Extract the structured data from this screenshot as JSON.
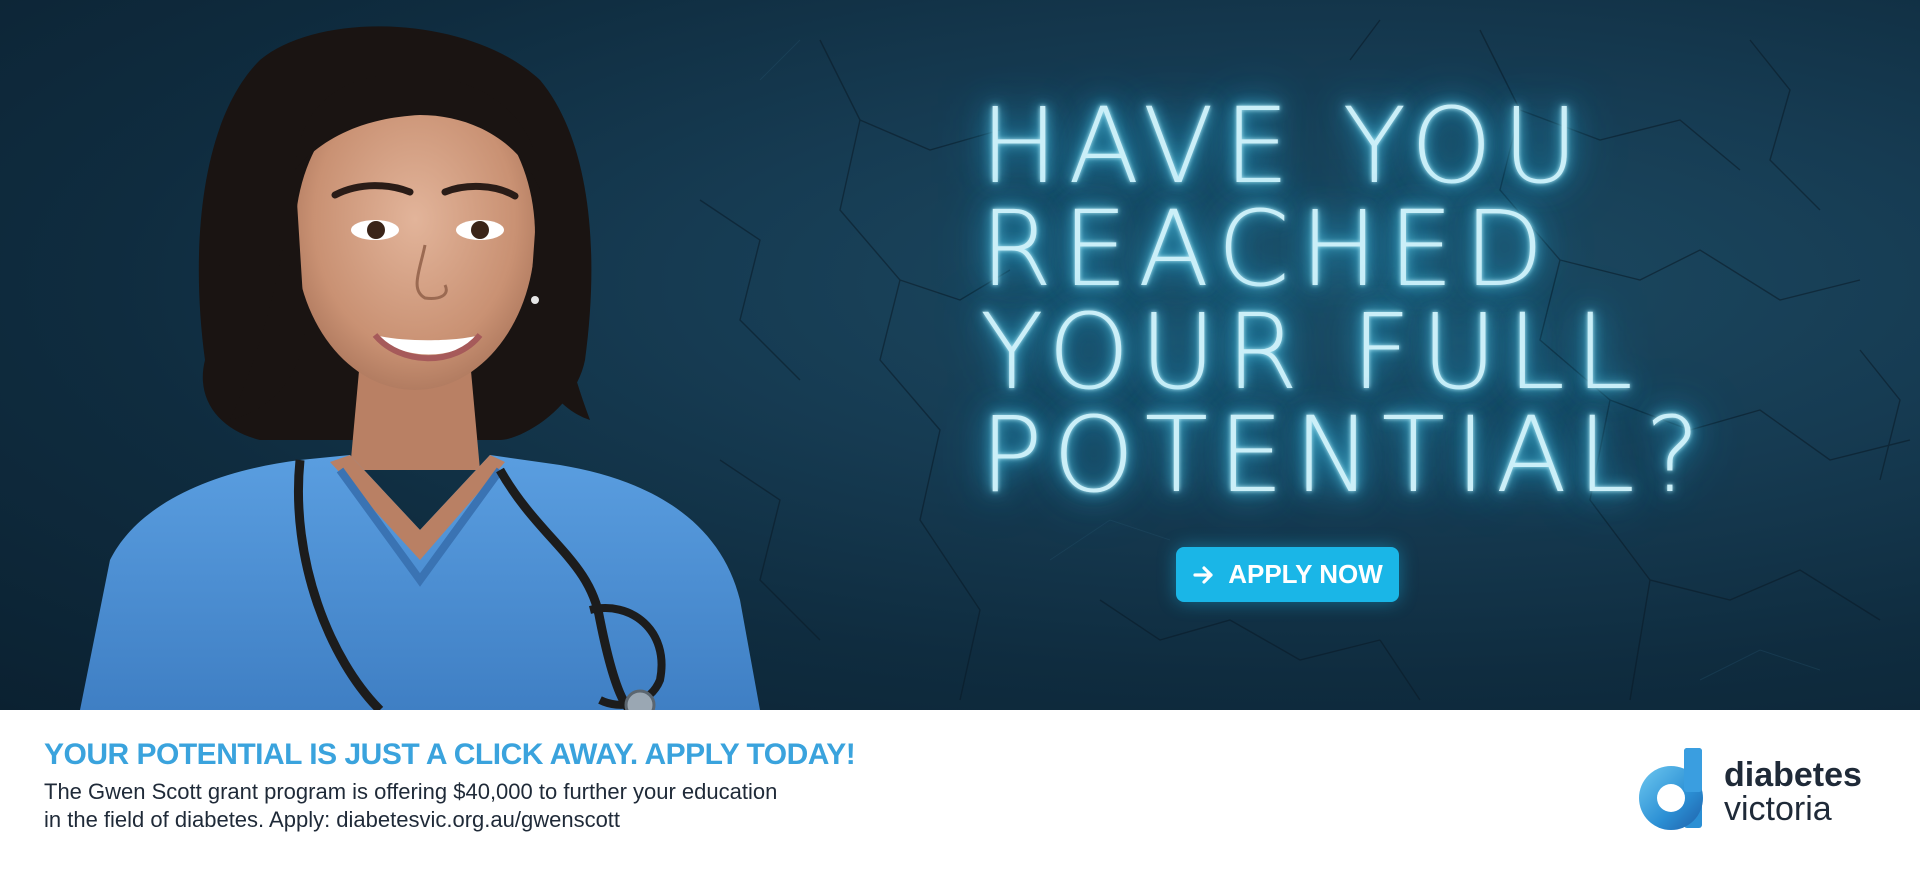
{
  "hero": {
    "neon_lines": [
      "HAVE YOU",
      "REACHED",
      "YOUR FULL",
      "POTENTIAL?"
    ],
    "cta_label": "APPLY NOW",
    "cta_icon": "arrow-right-icon",
    "colors": {
      "background": "#163b52",
      "neon": "#cbeff8",
      "cta": "#1ab6e7",
      "scrubs": "#4a8fd1"
    }
  },
  "footer": {
    "headline": "YOUR POTENTIAL IS JUST A CLICK AWAY. APPLY TODAY!",
    "body_line1": "The Gwen Scott grant program is offering $40,000 to further your education",
    "body_line2": "in the field of diabetes. Apply: diabetesvic.org.au/gwenscott",
    "colors": {
      "headline": "#3aa3dd",
      "text": "#1f2a38"
    }
  },
  "logo": {
    "line1": "diabetes",
    "line2": "victoria",
    "icon": "diabetes-victoria-logo-icon"
  }
}
